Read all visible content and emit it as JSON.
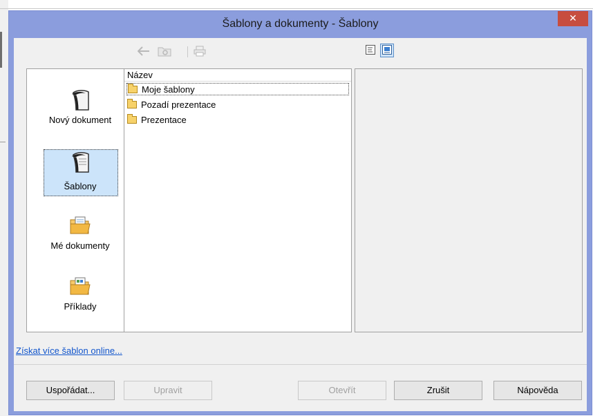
{
  "window": {
    "title": "Šablony a dokumenty - Šablony",
    "close_glyph": "✕"
  },
  "toolbar": {
    "back_icon": "arrow-left-icon",
    "up_icon": "folder-up-icon",
    "print_icon": "print-icon",
    "details_view_icon": "details-view-icon",
    "preview_view_icon": "preview-view-icon"
  },
  "nav": {
    "items": [
      {
        "label": "Nový dokument",
        "icon": "new-document-icon",
        "selected": false
      },
      {
        "label": "Šablony",
        "icon": "templates-icon",
        "selected": true
      },
      {
        "label": "Mé dokumenty",
        "icon": "my-documents-icon",
        "selected": false
      },
      {
        "label": "Příklady",
        "icon": "examples-icon",
        "selected": false
      }
    ]
  },
  "list": {
    "column_header": "Název",
    "rows": [
      {
        "label": "Moje šablony",
        "icon": "folder-icon"
      },
      {
        "label": "Pozadí prezentace",
        "icon": "folder-icon"
      },
      {
        "label": "Prezentace",
        "icon": "folder-icon"
      }
    ]
  },
  "link": {
    "label": "Získat více šablon online..."
  },
  "buttons": {
    "organize": "Uspořádat...",
    "edit": "Upravit",
    "open": "Otevřít",
    "cancel": "Zrušit",
    "help": "Nápověda"
  }
}
